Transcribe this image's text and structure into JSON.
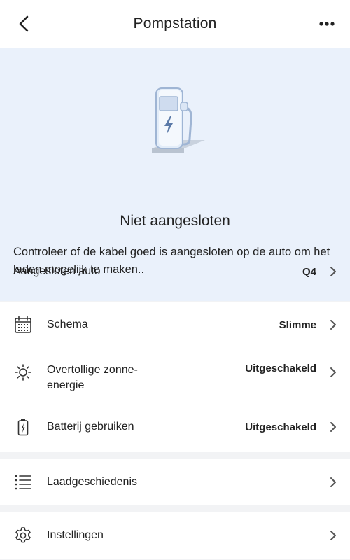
{
  "header": {
    "title": "Pompstation",
    "back_icon": "chevron-left-icon",
    "more_icon": "more-horizontal-icon"
  },
  "status": {
    "illustration": "charging-station-icon",
    "title": "Niet aangesloten",
    "description": "Controleer of de kabel goed is aangesloten op de auto om het laden mogelijk te maken..",
    "connected_car_label": "Aangesloten auto",
    "connected_car_value": "Q4"
  },
  "settings": [
    {
      "icon": "calendar-icon",
      "label": "Schema",
      "value": "Slimme"
    },
    {
      "icon": "sun-icon",
      "label_line1": "Overtollige zonne-",
      "label_line2": "energie",
      "value": "Uitgeschakeld"
    },
    {
      "icon": "battery-icon",
      "label": "Batterij gebruiken",
      "value": "Uitgeschakeld"
    }
  ],
  "history": {
    "icon": "list-icon",
    "label": "Laadgeschiedenis"
  },
  "instellingen": {
    "icon": "gear-icon",
    "label": "Instellingen"
  },
  "colors": {
    "status_background": "#eaf1fb",
    "page_background": "#f2f3f5",
    "card_background": "#ffffff",
    "text": "#222222"
  }
}
